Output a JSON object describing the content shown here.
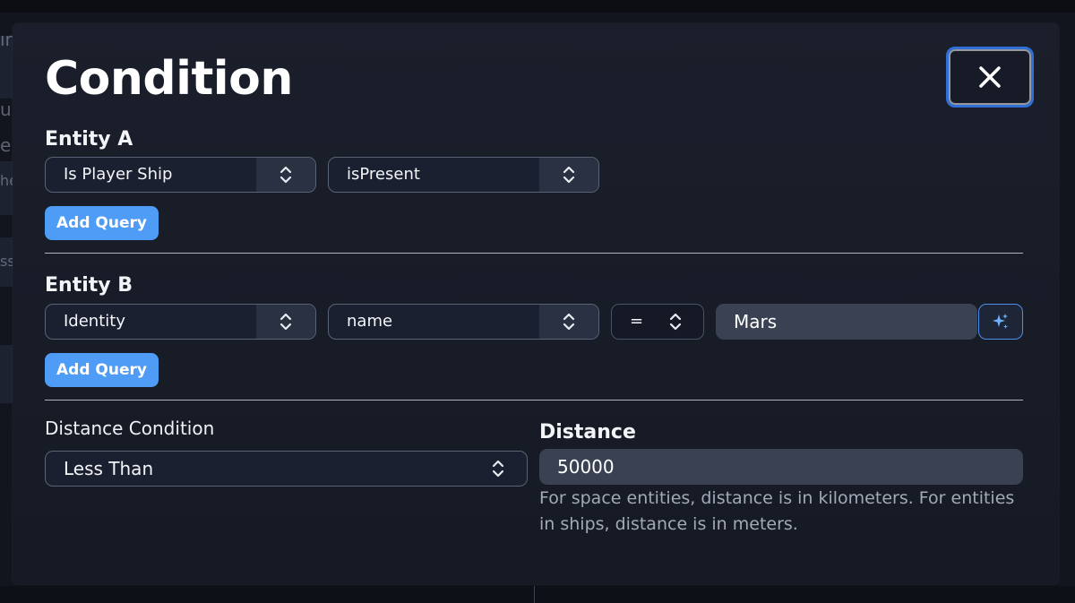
{
  "modal": {
    "title": "Condition",
    "close_icon": "close-x-icon"
  },
  "entity_a": {
    "label": "Entity A",
    "query_type": "Is Player Ship",
    "query_value": "isPresent",
    "add_query_label": "Add Query"
  },
  "entity_b": {
    "label": "Entity B",
    "query_type": "Identity",
    "field": "name",
    "operator": "=",
    "value": "Mars",
    "value_icon": "sparkle-icon",
    "add_query_label": "Add Query"
  },
  "distance": {
    "condition_label": "Distance Condition",
    "condition_value": "Less Than",
    "distance_label": "Distance",
    "distance_value": "50000",
    "helper_text": "For space entities, distance is in kilometers. For entities in ships, distance is in meters."
  },
  "background": {
    "letters": [
      "ır",
      "u",
      "e",
      "he",
      "ss"
    ]
  },
  "colors": {
    "accent": "#4f9cf6",
    "close_border": "#2f6fd6",
    "modal_bg": "#1a1f2b",
    "input_bg": "#3a4152"
  }
}
